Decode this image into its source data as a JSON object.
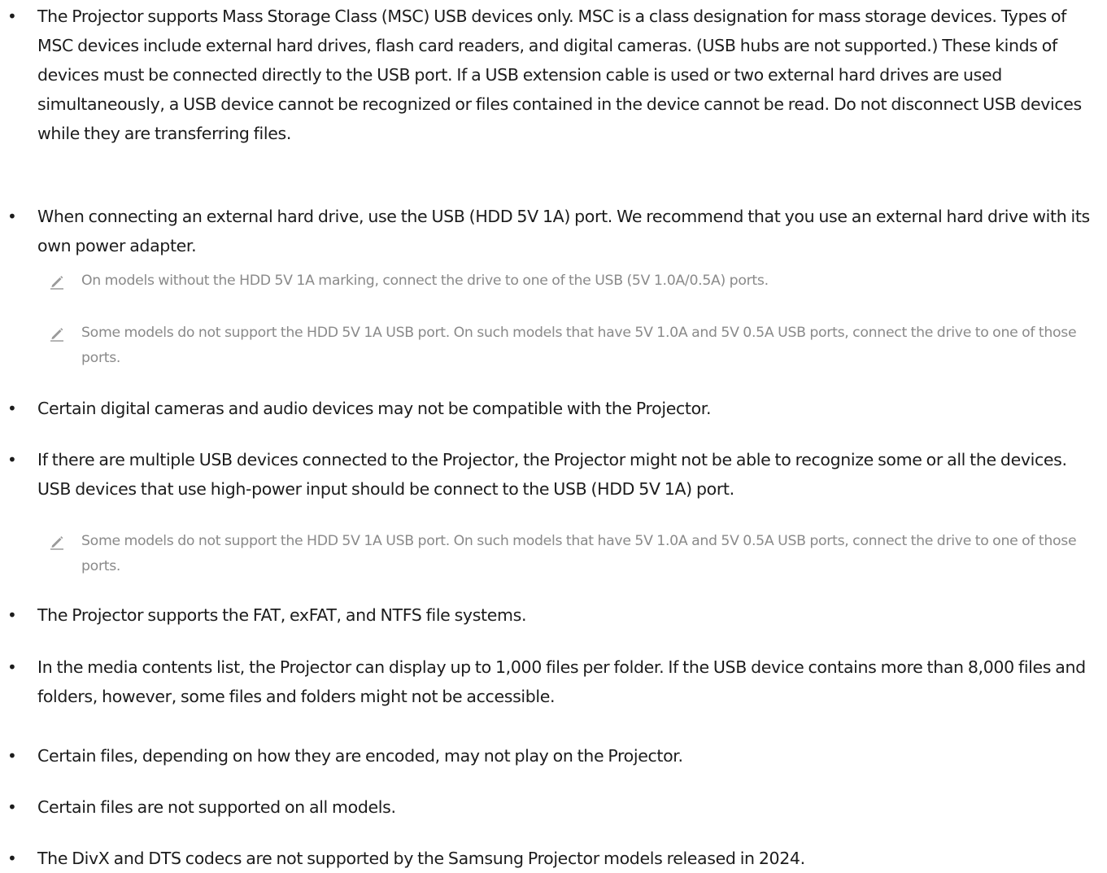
{
  "items": [
    {
      "type": "bullet",
      "text": "The Projector supports Mass Storage Class (MSC) USB devices only. MSC is a class designation for mass storage devices. Types of MSC devices include external hard drives, flash card readers, and digital cameras. (USB hubs are not supported.) These kinds of devices must be connected directly to the USB port. If a USB extension cable is used or two external hard drives are used simultaneously, a USB device cannot be recognized or files contained in the device cannot be read. Do not disconnect USB devices while they are transferring files."
    },
    {
      "type": "bullet",
      "text": "When connecting an external hard drive, use the USB (HDD 5V 1A) port. We recommend that you use an external hard drive with its own power adapter."
    },
    {
      "type": "note",
      "text": "On models without the HDD 5V 1A marking, connect the drive to one of the USB (5V 1.0A/0.5A) ports."
    },
    {
      "type": "note",
      "text": "Some models do not support the HDD 5V 1A USB port. On such models that have 5V 1.0A and 5V 0.5A USB ports, connect the drive to one of those ports."
    },
    {
      "type": "bullet",
      "text": "Certain digital cameras and audio devices may not be compatible with the Projector."
    },
    {
      "type": "bullet",
      "text": "If there are multiple USB devices connected to the Projector, the Projector might not be able to recognize some or all the devices. USB devices that use high-power input should be connect to the USB (HDD 5V 1A) port."
    },
    {
      "type": "note",
      "text": "Some models do not support the HDD 5V 1A USB port. On such models that have 5V 1.0A and 5V 0.5A USB ports, connect the drive to one of those ports."
    },
    {
      "type": "bullet",
      "text": "The Projector supports the FAT, exFAT, and NTFS file systems."
    },
    {
      "type": "bullet",
      "text": "In the media contents list, the Projector can display up to 1,000 files per folder. If the USB device contains more than 8,000 files and folders, however, some files and folders might not be accessible."
    },
    {
      "type": "bullet",
      "text": "Certain files, depending on how they are encoded, may not play on the Projector."
    },
    {
      "type": "bullet",
      "text": "Certain files are not supported on all models."
    },
    {
      "type": "bullet",
      "text": "The DivX and DTS codecs are not supported by the Samsung Projector models released in 2024."
    }
  ],
  "icons": {
    "bullet": "•",
    "note": "pencil-icon"
  },
  "colors": {
    "body_text": "#1c1c1c",
    "note_text": "#8a8a8a"
  }
}
